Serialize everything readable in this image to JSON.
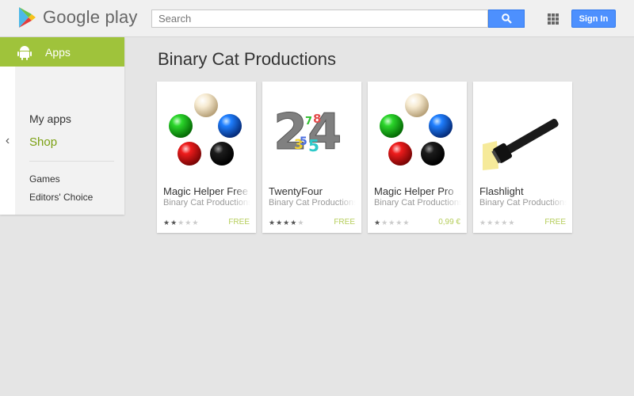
{
  "header": {
    "logo_text": "Google play",
    "search_placeholder": "Search",
    "signin_label": "Sign In"
  },
  "sidebar": {
    "section_label": "Apps",
    "links": [
      "My apps",
      "Shop"
    ],
    "sub_links": [
      "Games",
      "Editors' Choice"
    ],
    "back_glyph": "‹"
  },
  "page": {
    "title": "Binary Cat Productions"
  },
  "apps": [
    {
      "title": "Magic Helper Free",
      "developer": "Binary Cat Productions",
      "rating": 2,
      "price": "FREE"
    },
    {
      "title": "TwentyFour",
      "developer": "Binary Cat Productions",
      "rating": 4,
      "price": "FREE"
    },
    {
      "title": "Magic Helper Pro",
      "developer": "Binary Cat Productions",
      "rating": 1,
      "price": "0,99 €"
    },
    {
      "title": "Flashlight",
      "developer": "Binary Cat Productions",
      "rating": 0,
      "price": "FREE"
    }
  ],
  "colors": {
    "apps_accent": "#9fc33b",
    "button_blue": "#4d90fe",
    "price_green": "#b5cd5a"
  }
}
